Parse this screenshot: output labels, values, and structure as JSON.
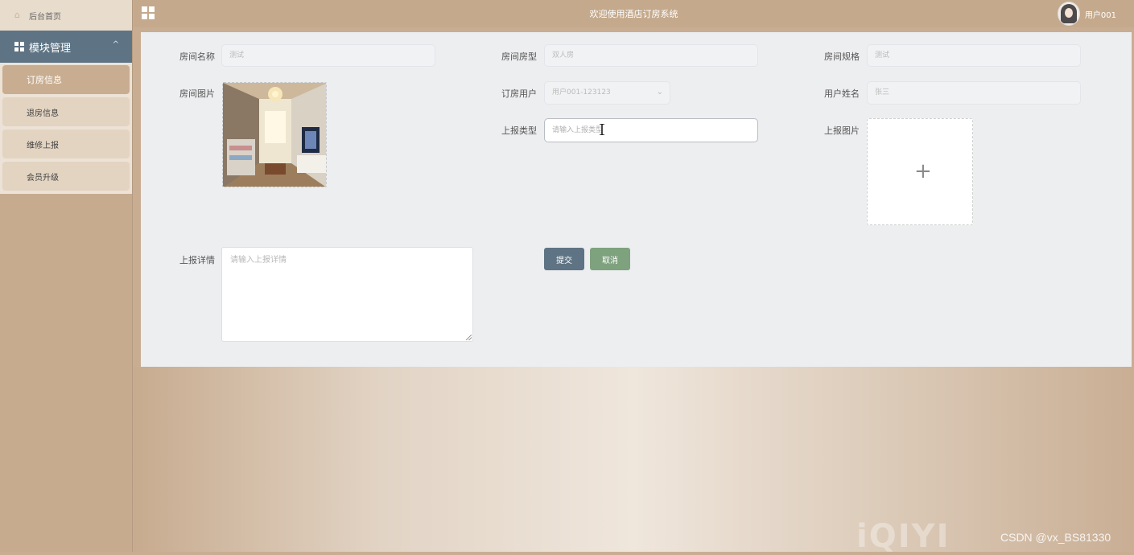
{
  "sidebar": {
    "home_label": "后台首页",
    "module_label": "模块管理",
    "items": [
      {
        "label": "订房信息",
        "active": true
      },
      {
        "label": "退房信息",
        "active": false
      },
      {
        "label": "维修上报",
        "active": false
      },
      {
        "label": "会员升级",
        "active": false
      }
    ]
  },
  "header": {
    "title": "欢迎使用酒店订房系统",
    "username": "用户001"
  },
  "form": {
    "room_name": {
      "label": "房间名称",
      "value": "测试"
    },
    "room_type": {
      "label": "房间房型",
      "value": "双人房"
    },
    "room_spec": {
      "label": "房间规格",
      "value": "测试"
    },
    "room_photo": {
      "label": "房间图片"
    },
    "booking_user": {
      "label": "订房用户",
      "value": "用户001-123123"
    },
    "user_name": {
      "label": "用户姓名",
      "value": "张三"
    },
    "report_type": {
      "label": "上报类型",
      "placeholder": "请输入上报类型"
    },
    "report_photo": {
      "label": "上报图片",
      "upload_icon": "+"
    },
    "report_detail": {
      "label": "上报详情",
      "placeholder": "请输入上报详情"
    },
    "submit_label": "提交",
    "cancel_label": "取消"
  },
  "watermarks": {
    "iqiyi": "iQIYI",
    "csdn": "CSDN @vx_BS81330"
  }
}
